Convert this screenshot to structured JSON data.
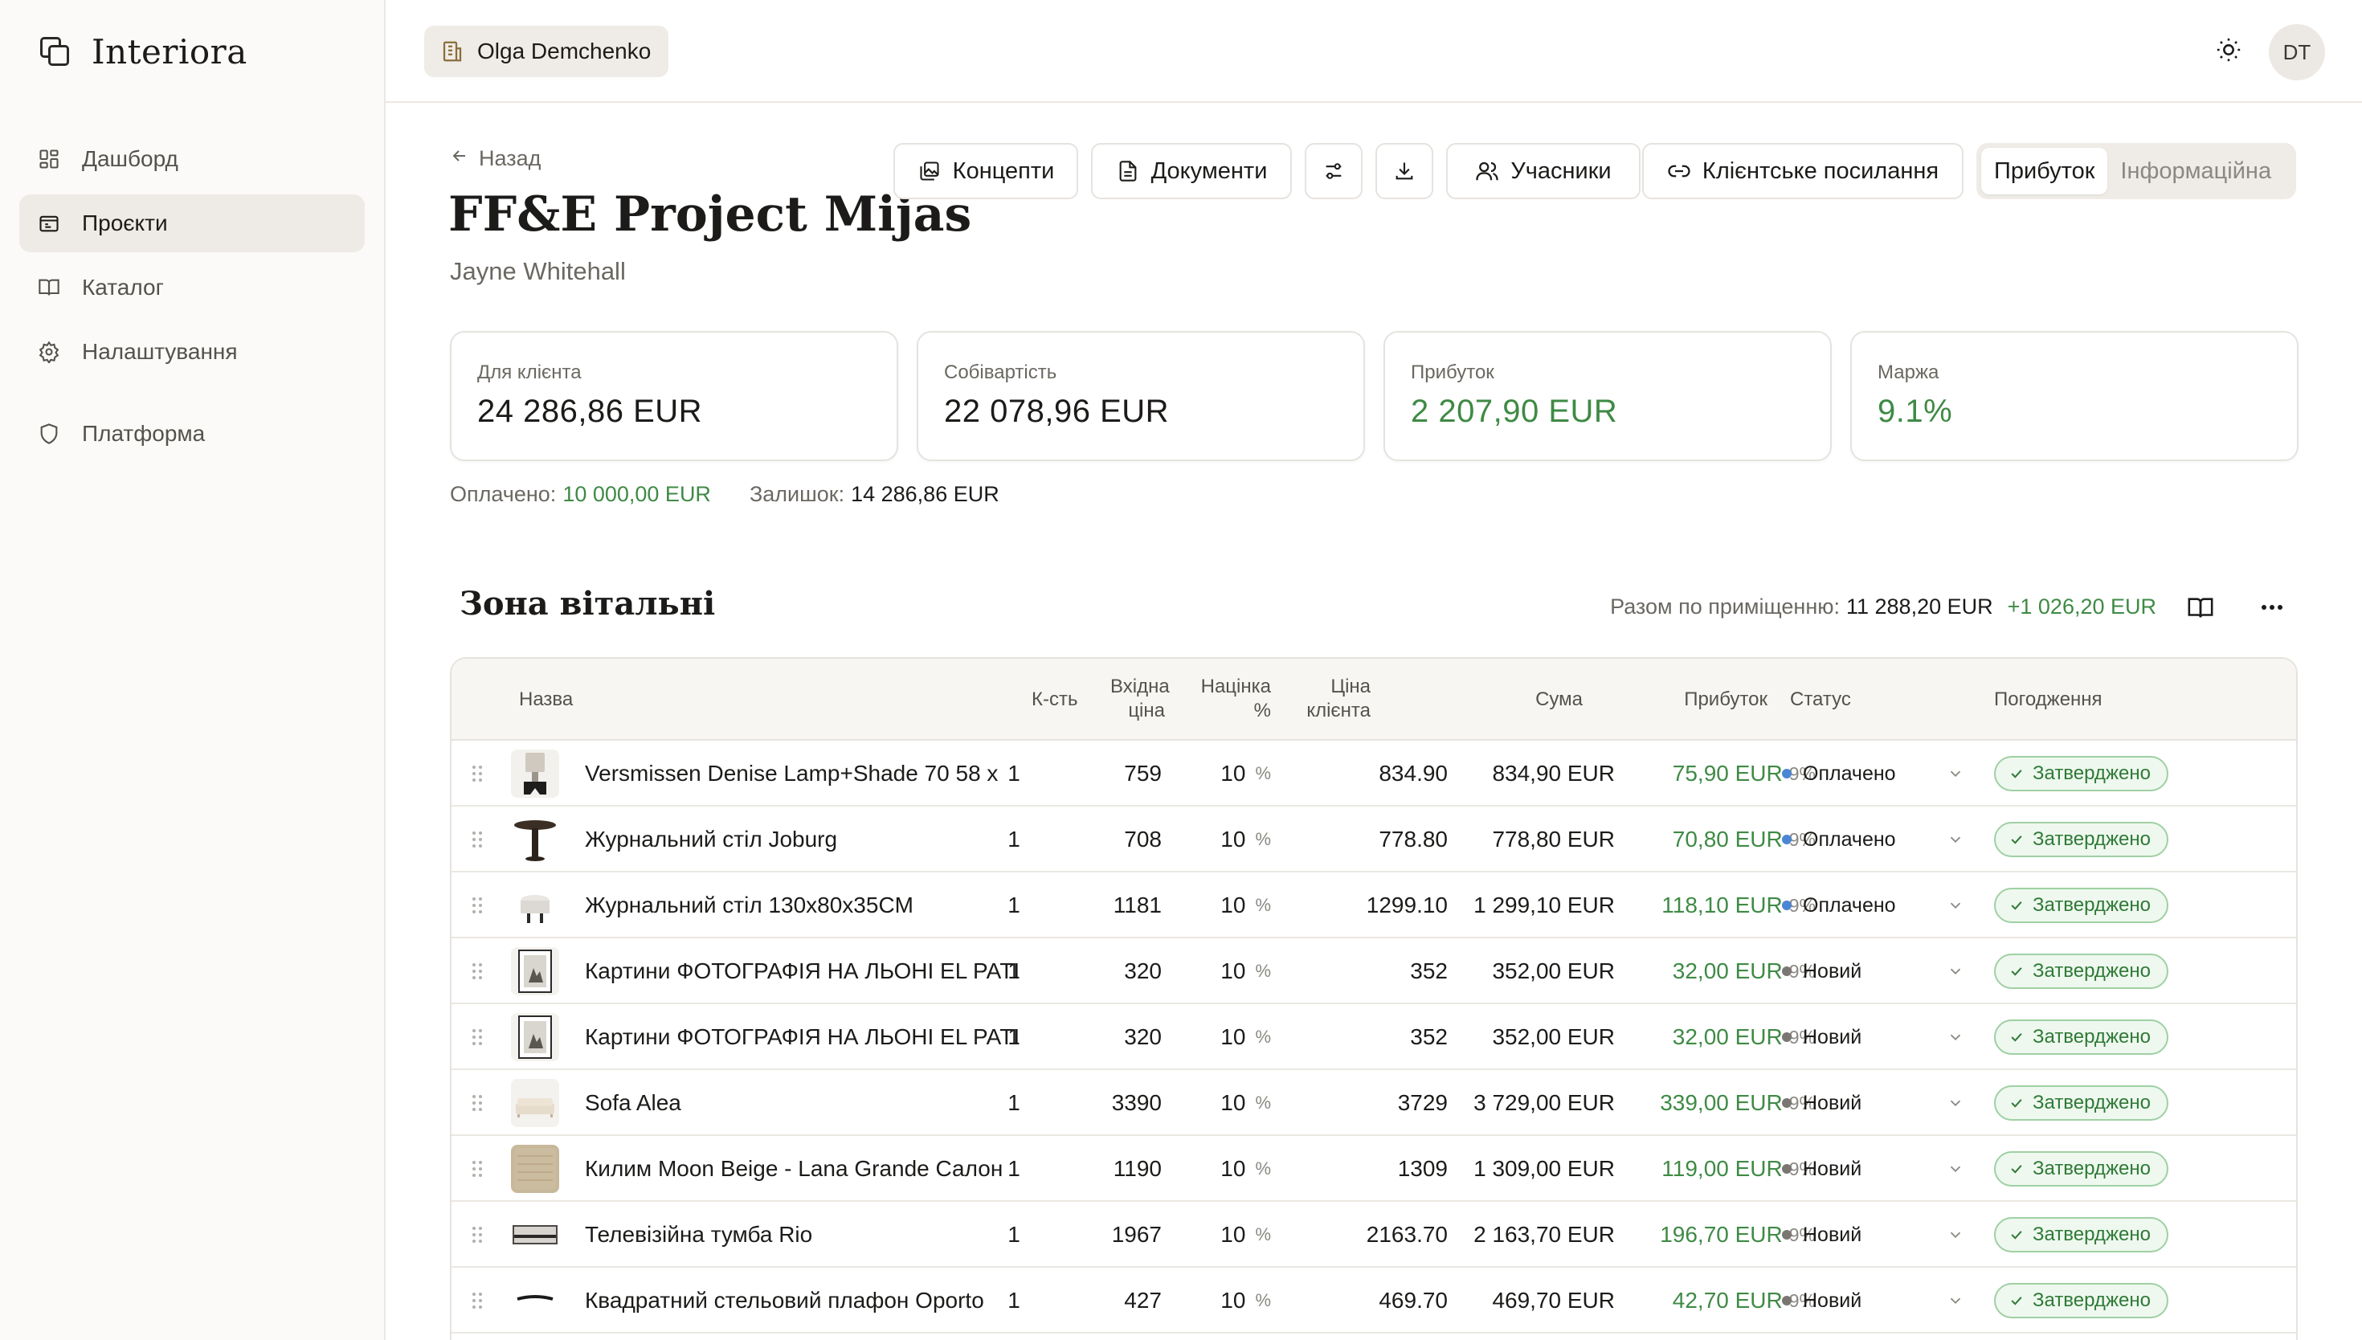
{
  "app": {
    "name": "Interiora"
  },
  "sidebar": {
    "items": [
      {
        "label": "Дашборд",
        "icon": "dashboard-icon"
      },
      {
        "label": "Проєкти",
        "icon": "folder-icon",
        "active": true
      },
      {
        "label": "Каталог",
        "icon": "book-icon"
      },
      {
        "label": "Налаштування",
        "icon": "gear-icon"
      },
      {
        "label": "Платформа",
        "icon": "shield-icon"
      }
    ]
  },
  "topbar": {
    "org_name": "Olga Demchenko",
    "avatar_initials": "DT"
  },
  "header": {
    "back_label": "Назад",
    "title": "FF&E Project Mijas",
    "client": "Jayne Whitehall"
  },
  "toolbar": {
    "concepts": "Концепти",
    "documents": "Документи",
    "participants": "Учасники",
    "client_link": "Клієнтське посилання",
    "view_profit": "Прибуток",
    "view_info": "Інформаційна"
  },
  "stats": {
    "client": {
      "label": "Для клієнта",
      "value": "24 286,86 EUR"
    },
    "cost": {
      "label": "Собівартість",
      "value": "22 078,96 EUR"
    },
    "profit": {
      "label": "Прибуток",
      "value": "2 207,90 EUR"
    },
    "margin": {
      "label": "Маржа",
      "value": "9.1%"
    }
  },
  "payments": {
    "paid_label": "Оплачено:",
    "paid_value": "10 000,00 EUR",
    "balance_label": "Залишок:",
    "balance_value": "14 286,86 EUR"
  },
  "zone": {
    "title": "Зона вітальні",
    "total_label": "Разом по приміщенню:",
    "total_value": "11 288,20 EUR",
    "total_profit": "+1 026,20 EUR"
  },
  "table": {
    "headers": {
      "name": "Назва",
      "qty": "К-сть",
      "price_l1": "Вхідна",
      "price_l2": "ціна",
      "markup_l1": "Націнка",
      "markup_l2": "%",
      "cprice_l1": "Ціна",
      "cprice_l2": "клієнта",
      "sum": "Сума",
      "profit": "Прибуток",
      "status": "Статус",
      "approval": "Погодження"
    },
    "rows": [
      {
        "name": "Versmissen Denise Lamp+Shade 70 58 x",
        "qty": "1",
        "price": "759",
        "markup": "10",
        "pct": "%",
        "client_price": "834.90",
        "sum": "834,90 EUR",
        "profit": "75,90 EUR",
        "profit_pct": "9%",
        "status": "Оплачено",
        "status_color": "#4a86d4",
        "approval": "Затверджено",
        "thumb": "lamp"
      },
      {
        "name": "Журнальний стіл Joburg",
        "qty": "1",
        "price": "708",
        "markup": "10",
        "pct": "%",
        "client_price": "778.80",
        "sum": "778,80 EUR",
        "profit": "70,80 EUR",
        "profit_pct": "9%",
        "status": "Оплачено",
        "status_color": "#4a86d4",
        "approval": "Затверджено",
        "thumb": "table-dark"
      },
      {
        "name": "Журнальний стіл 130x80x35CM",
        "qty": "1",
        "price": "1181",
        "markup": "10",
        "pct": "%",
        "client_price": "1299.10",
        "sum": "1 299,10 EUR",
        "profit": "118,10 EUR",
        "profit_pct": "9%",
        "status": "Оплачено",
        "status_color": "#4a86d4",
        "approval": "Затверджено",
        "thumb": "table-white"
      },
      {
        "name": "Картини ФОТОГРАФІЯ НА ЛЬОНІ EL PATI",
        "qty": "1",
        "price": "320",
        "markup": "10",
        "pct": "%",
        "client_price": "352",
        "sum": "352,00 EUR",
        "profit": "32,00 EUR",
        "profit_pct": "9%",
        "status": "Новий",
        "status_color": "#7a7772",
        "approval": "Затверджено",
        "thumb": "frame"
      },
      {
        "name": "Картини ФОТОГРАФІЯ НА ЛЬОНІ EL PATI",
        "qty": "1",
        "price": "320",
        "markup": "10",
        "pct": "%",
        "client_price": "352",
        "sum": "352,00 EUR",
        "profit": "32,00 EUR",
        "profit_pct": "9%",
        "status": "Новий",
        "status_color": "#7a7772",
        "approval": "Затверджено",
        "thumb": "frame"
      },
      {
        "name": "Sofa Alea",
        "qty": "1",
        "price": "3390",
        "markup": "10",
        "pct": "%",
        "client_price": "3729",
        "sum": "3 729,00 EUR",
        "profit": "339,00 EUR",
        "profit_pct": "9%",
        "status": "Новий",
        "status_color": "#7a7772",
        "approval": "Затверджено",
        "thumb": "sofa"
      },
      {
        "name": "Килим Moon Beige - Lana Grande Салон",
        "qty": "1",
        "price": "1190",
        "markup": "10",
        "pct": "%",
        "client_price": "1309",
        "sum": "1 309,00 EUR",
        "profit": "119,00 EUR",
        "profit_pct": "9%",
        "status": "Новий",
        "status_color": "#7a7772",
        "approval": "Затверджено",
        "thumb": "rug"
      },
      {
        "name": "Телевізійна тумба Rio",
        "qty": "1",
        "price": "1967",
        "markup": "10",
        "pct": "%",
        "client_price": "2163.70",
        "sum": "2 163,70 EUR",
        "profit": "196,70 EUR",
        "profit_pct": "9%",
        "status": "Новий",
        "status_color": "#7a7772",
        "approval": "Затверджено",
        "thumb": "tvstand"
      },
      {
        "name": "Квадратний стельовий плафон Oporto",
        "qty": "1",
        "price": "427",
        "markup": "10",
        "pct": "%",
        "client_price": "469.70",
        "sum": "469,70 EUR",
        "profit": "42,70 EUR",
        "profit_pct": "9%",
        "status": "Новий",
        "status_color": "#7a7772",
        "approval": "Затверджено",
        "thumb": "ceiling"
      }
    ]
  }
}
